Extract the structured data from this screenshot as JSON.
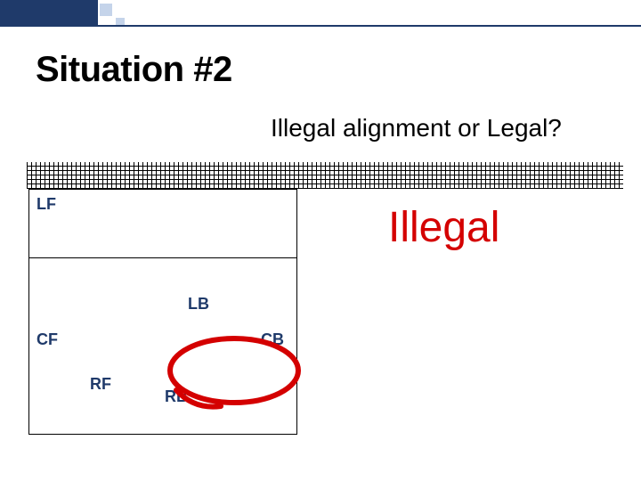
{
  "title": "Situation #2",
  "subtitle": "Illegal alignment or Legal?",
  "verdict": "Illegal",
  "positions": {
    "LF": "LF",
    "LB": "LB",
    "CF": "CF",
    "CB": "CB",
    "RF": "RF",
    "RB": "RB"
  }
}
